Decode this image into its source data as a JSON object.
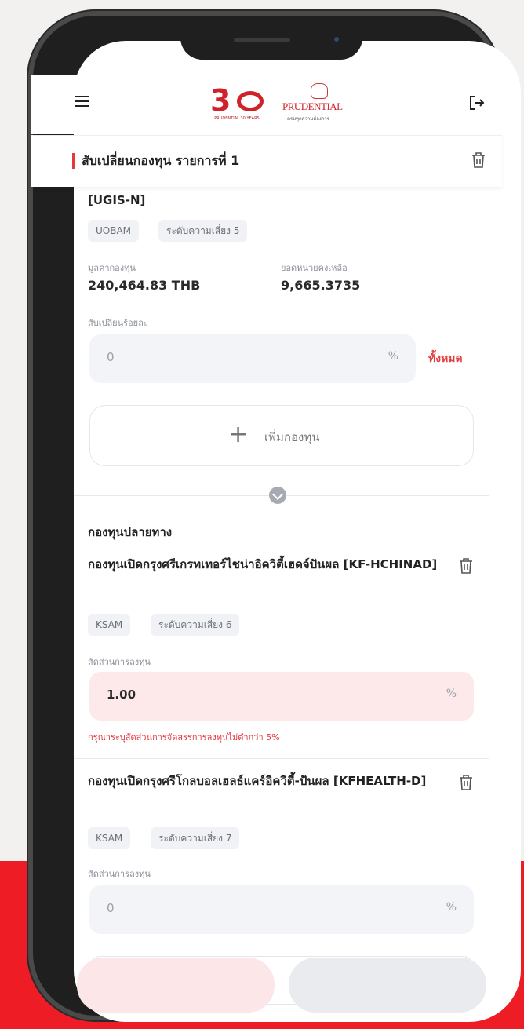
{
  "header": {
    "menu_icon": "menu-icon",
    "logo_30_number": "3",
    "logo_30_subtitle": "PRUDENTIAL 30 YEARS",
    "logo_brand": "PRUDENTIAL",
    "logo_tagline": "ครบทุกความต้องการ",
    "logout_icon": "logout-icon"
  },
  "section": {
    "title": "สับเปลี่ยนกองทุน รายการที่ 1"
  },
  "source_fund": {
    "code": "[UGIS-N]",
    "amc": "UOBAM",
    "risk": "ระดับความเสี่ยง 5",
    "nav_label": "มูลค่ากองทุน",
    "nav_value": "240,464.83 THB",
    "units_label": "ยอดหน่วยคงเหลือ",
    "units_value": "9,665.3735",
    "switch_label": "สับเปลี่ยนร้อยละ",
    "switch_value": "0",
    "switch_unit": "%",
    "all_link": "ทั้งหมด"
  },
  "add_fund_button": {
    "plus": "+",
    "label": "เพิ่มกองทุน"
  },
  "destination": {
    "title": "กองทุนปลายทาง",
    "funds": [
      {
        "name": "กองทุนเปิดกรุงศรีเกรทเทอร์ไชน่าอิควิตี้เฮดจ์ปันผล [KF-HCHINAD]",
        "amc": "KSAM",
        "risk": "ระดับความเสี่ยง 6",
        "ratio_label": "สัดส่วนการลงทุน",
        "ratio_value": "1.00",
        "unit": "%",
        "error": "กรุณาระบุสัดส่วนการจัดสรรการลงทุนไม่ต่ำกว่า 5%"
      },
      {
        "name": "กองทุนเปิดกรุงศรีโกลบอลเฮลธ์แคร์อิควิตี้-ปันผล [KFHEALTH-D]",
        "amc": "KSAM",
        "risk": "ระดับความเสี่ยง 7",
        "ratio_label": "สัดส่วนการลงทุน",
        "ratio_value": "0",
        "unit": "%"
      }
    ]
  },
  "colors": {
    "accent_red": "#ee1c25",
    "error_red": "#e0343c",
    "chip_bg": "#f1f2f5"
  }
}
